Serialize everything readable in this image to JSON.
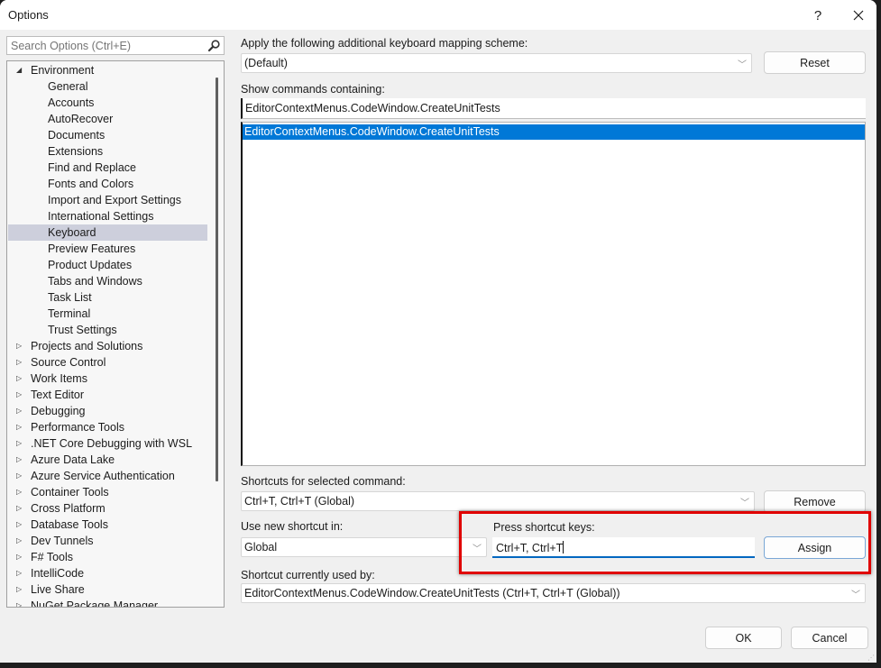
{
  "window": {
    "title": "Options",
    "help_label": "?",
    "close_label": "✕"
  },
  "search": {
    "placeholder": "Search Options (Ctrl+E)",
    "icon": "search-icon"
  },
  "tree": {
    "items": [
      {
        "label": "Environment",
        "level": 0,
        "state": "expanded"
      },
      {
        "label": "General",
        "level": 1
      },
      {
        "label": "Accounts",
        "level": 1
      },
      {
        "label": "AutoRecover",
        "level": 1
      },
      {
        "label": "Documents",
        "level": 1
      },
      {
        "label": "Extensions",
        "level": 1
      },
      {
        "label": "Find and Replace",
        "level": 1
      },
      {
        "label": "Fonts and Colors",
        "level": 1
      },
      {
        "label": "Import and Export Settings",
        "level": 1
      },
      {
        "label": "International Settings",
        "level": 1
      },
      {
        "label": "Keyboard",
        "level": 1,
        "selected": true
      },
      {
        "label": "Preview Features",
        "level": 1
      },
      {
        "label": "Product Updates",
        "level": 1
      },
      {
        "label": "Tabs and Windows",
        "level": 1
      },
      {
        "label": "Task List",
        "level": 1
      },
      {
        "label": "Terminal",
        "level": 1
      },
      {
        "label": "Trust Settings",
        "level": 1
      },
      {
        "label": "Projects and Solutions",
        "level": 0,
        "state": "collapsed"
      },
      {
        "label": "Source Control",
        "level": 0,
        "state": "collapsed"
      },
      {
        "label": "Work Items",
        "level": 0,
        "state": "collapsed"
      },
      {
        "label": "Text Editor",
        "level": 0,
        "state": "collapsed"
      },
      {
        "label": "Debugging",
        "level": 0,
        "state": "collapsed"
      },
      {
        "label": "Performance Tools",
        "level": 0,
        "state": "collapsed"
      },
      {
        "label": ".NET Core Debugging with WSL",
        "level": 0,
        "state": "collapsed"
      },
      {
        "label": "Azure Data Lake",
        "level": 0,
        "state": "collapsed"
      },
      {
        "label": "Azure Service Authentication",
        "level": 0,
        "state": "collapsed"
      },
      {
        "label": "Container Tools",
        "level": 0,
        "state": "collapsed"
      },
      {
        "label": "Cross Platform",
        "level": 0,
        "state": "collapsed"
      },
      {
        "label": "Database Tools",
        "level": 0,
        "state": "collapsed"
      },
      {
        "label": "Dev Tunnels",
        "level": 0,
        "state": "collapsed"
      },
      {
        "label": "F# Tools",
        "level": 0,
        "state": "collapsed"
      },
      {
        "label": "IntelliCode",
        "level": 0,
        "state": "collapsed"
      },
      {
        "label": "Live Share",
        "level": 0,
        "state": "collapsed"
      },
      {
        "label": "NuGet Package Manager",
        "level": 0,
        "state": "collapsed"
      }
    ]
  },
  "keyboard": {
    "mapping_label": "Apply the following additional keyboard mapping scheme:",
    "mapping_value": "(Default)",
    "reset_label": "Reset",
    "show_commands_label": "Show commands containing:",
    "show_commands_value": "EditorContextMenus.CodeWindow.CreateUnitTests",
    "commands": [
      "EditorContextMenus.CodeWindow.CreateUnitTests"
    ],
    "shortcuts_label": "Shortcuts for selected command:",
    "shortcuts_value": "Ctrl+T, Ctrl+T (Global)",
    "remove_label": "Remove",
    "use_in_label": "Use new shortcut in:",
    "use_in_value": "Global",
    "press_keys_label": "Press shortcut keys:",
    "press_keys_value": "Ctrl+T, Ctrl+T",
    "assign_label": "Assign",
    "used_by_label": "Shortcut currently used by:",
    "used_by_value": "EditorContextMenus.CodeWindow.CreateUnitTests (Ctrl+T, Ctrl+T (Global))"
  },
  "footer": {
    "ok_label": "OK",
    "cancel_label": "Cancel"
  },
  "colors": {
    "selection": "#0078d7",
    "tree_selection": "#cdcfdc",
    "highlight": "#e00000",
    "focus_underline": "#0067c0"
  }
}
